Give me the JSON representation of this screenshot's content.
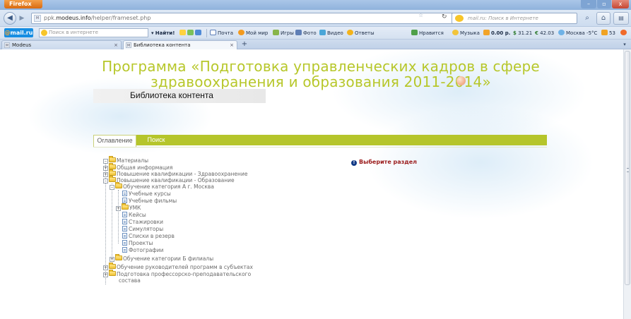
{
  "browser": {
    "app_button": "Firefox",
    "window_controls": {
      "minimize": "–",
      "maximize": "▫",
      "close": "x"
    },
    "url_prefix": "ppk.",
    "url_host": "modeus.info",
    "url_path": "/helper/frameset.php",
    "search_placeholder": "mail.ru: Поиск в Интернете",
    "bookmarks": {
      "mailru_logo_mail": "mail",
      "mailru_logo_ru": ".ru",
      "search_placeholder": "Поиск в интернете",
      "find": "Найти!",
      "mail": "Почта",
      "my_world": "Мой мир",
      "games": "Игры",
      "photo": "Фото",
      "video": "Видео",
      "answers": "Ответы",
      "like": "Нравится",
      "music": "Музыка",
      "money": "0.00 р.",
      "usd": "31.21",
      "eur": "42.03",
      "weather": "Москва -5°C",
      "count": "53"
    },
    "tabs": [
      {
        "label": "Modeus"
      },
      {
        "label": "Библиотека контента"
      }
    ]
  },
  "page": {
    "header_line1": "Программа «Подготовка управленческих кадров в сфере",
    "header_line2": "здравоохранения и образования 2011-2014»",
    "library_title": "Библиотека контента",
    "tab_contents": "Оглавление",
    "tab_search": "Поиск",
    "select_message": "Выберите раздел",
    "tree": {
      "root": "Материалы",
      "general": "Общая информация",
      "qual_health": "Повышение квалификации - Здравоохранение",
      "qual_edu": "Повышение квалификации - Образование",
      "cat_a": "Обучение категория А г. Москва",
      "courses": "Учебные курсы",
      "films": "Учебные фильмы",
      "umk": "УМК",
      "cases": "Кейсы",
      "intern": "Стажировки",
      "simulators": "Симуляторы",
      "reserve": "Списки в резерв",
      "projects": "Проекты",
      "photos": "Фотографии",
      "cat_b": "Обучение категории Б филиалы",
      "leaders": "Обучение руководителей программ в субъектах",
      "staff_line1": "Подготовка профессорско-преподавательского",
      "staff_line2": "состава"
    }
  },
  "colors": {
    "accent_green": "#b5c52b",
    "title_green": "#b7c72a",
    "message_red": "#9b1c1c"
  }
}
